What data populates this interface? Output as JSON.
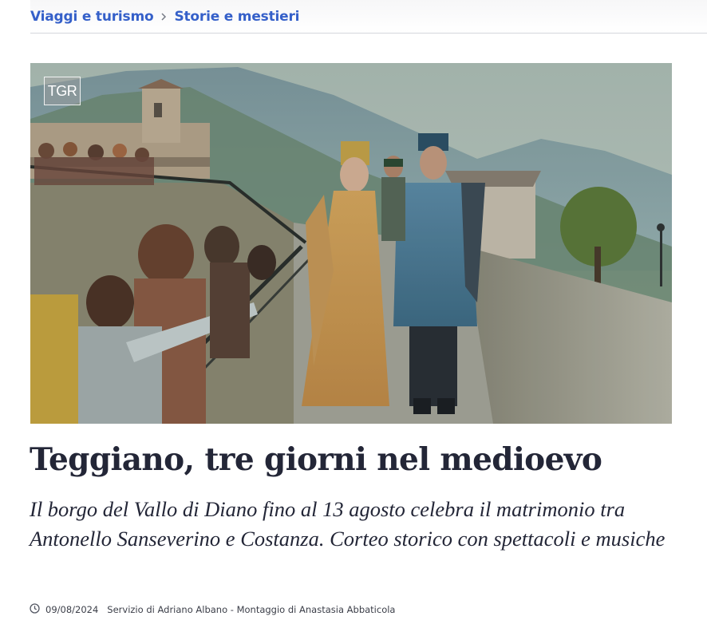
{
  "breadcrumb": {
    "items": [
      {
        "label": "Viaggi e turismo"
      },
      {
        "label": "Storie e mestieri"
      }
    ],
    "separator_icon": "chevron-right-icon"
  },
  "media": {
    "logo_text": "TGR",
    "description_icon": "video-still"
  },
  "article": {
    "title": "Teggiano, tre giorni nel medioevo",
    "subtitle": "Il borgo del Vallo di Diano fino al 13 agosto celebra il matrimonio tra Antonello Sanseverino e Costanza. Corteo storico con spettacoli e musiche",
    "date": "09/08/2024",
    "credits": "Servizio di Adriano Albano - Montaggio di Anastasia Abbaticola",
    "date_icon": "clock-icon"
  },
  "colors": {
    "link": "#3560c9",
    "text": "#232637",
    "divider": "#d4d6dc"
  }
}
